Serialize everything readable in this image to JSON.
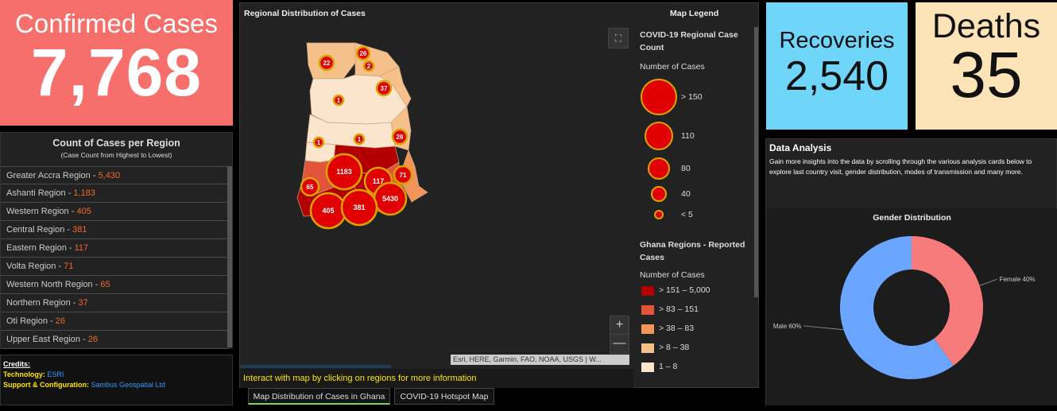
{
  "confirmed": {
    "title": "Confirmed Cases",
    "value": "7,768"
  },
  "recoveries": {
    "title": "Recoveries",
    "value": "2,540"
  },
  "deaths": {
    "title": "Deaths",
    "value": "35"
  },
  "region_panel": {
    "title": "Count of Cases per Region",
    "subtitle": "(Case Count from Highest to Lowest)",
    "items": [
      {
        "name": "Greater Accra Region - ",
        "count": "5,430"
      },
      {
        "name": "Ashanti Region - ",
        "count": "1,183"
      },
      {
        "name": "Western Region - ",
        "count": "405"
      },
      {
        "name": "Central Region - ",
        "count": "381"
      },
      {
        "name": "Eastern Region - ",
        "count": "117"
      },
      {
        "name": "Volta Region - ",
        "count": "71"
      },
      {
        "name": "Western North Region - ",
        "count": "65"
      },
      {
        "name": "Northern Region - ",
        "count": "37"
      },
      {
        "name": "Oti Region - ",
        "count": "26"
      },
      {
        "name": "Upper East Region - ",
        "count": "26"
      }
    ]
  },
  "credits": {
    "title": "Credits:",
    "technology_label": "Technology:",
    "technology_value": "ESRI",
    "support_label": "Support & Configuration:",
    "support_value": "Sambus Geospatial Ltd"
  },
  "map": {
    "title": "Regional Distribution of Cases",
    "legend_title": "Map Legend",
    "info": "Interact with map by clicking on regions for more information",
    "attribution": "Esri, HERE, Garmin, FAO, NOAA, USGS | W...",
    "zoom_in": "+",
    "zoom_out": "—",
    "expand_icon": "⛶",
    "clusters": [
      "22",
      "26",
      "2",
      "37",
      "1",
      "1",
      "1",
      "26",
      "1183",
      "117",
      "71",
      "65",
      "5430",
      "405",
      "381"
    ],
    "legend": {
      "layer1_title": "COVID-19 Regional Case Count",
      "layer1_sub": "Number of Cases",
      "sizes": [
        "> 150",
        "110",
        "80",
        "40",
        "< 5"
      ],
      "layer2_title": "Ghana Regions - Reported Cases",
      "layer2_sub": "Number of Cases",
      "classes": [
        "> 151 – 5,000",
        "> 83 – 151",
        "> 38 – 83",
        "> 8 – 38",
        "1 – 8"
      ],
      "class_colors": [
        "#b20000",
        "#e2553a",
        "#f1955a",
        "#f5c08a",
        "#fbe6cd"
      ]
    }
  },
  "tabs": [
    "Map Distribution of Cases in Ghana",
    "COVID-19 Hotspot Map"
  ],
  "analysis": {
    "title": "Data Analysis",
    "description": "Gain more insights into the data by scrolling through the various analysis cards below to explore last country visit, gender distribution, modes of transmission and many more.",
    "gender_title": "Gender Distribution"
  },
  "chart_data": {
    "type": "pie",
    "title": "Gender Distribution",
    "categories": [
      "Female",
      "Male"
    ],
    "values": [
      40,
      60
    ],
    "labels": [
      "Female 40%",
      "Male 60%"
    ],
    "colors": [
      "#f77b7b",
      "#6aa6ff"
    ],
    "donut": true
  }
}
